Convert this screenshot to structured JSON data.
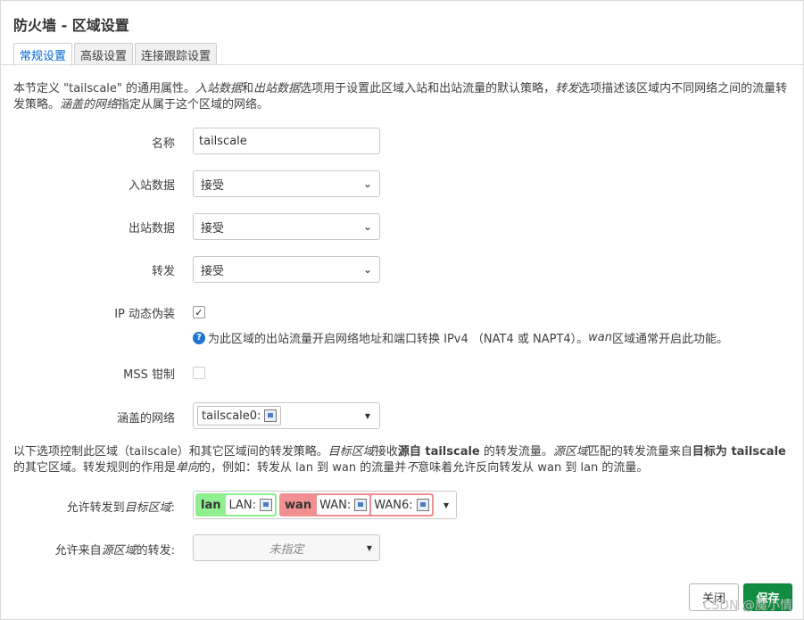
{
  "dialog": {
    "title": "防火墙 - 区域设置",
    "tabs": [
      {
        "label": "常规设置",
        "active": true
      },
      {
        "label": "高级设置",
        "active": false
      },
      {
        "label": "连接跟踪设置",
        "active": false
      }
    ],
    "description": {
      "p1": "本节定义 \"tailscale\" 的通用属性。",
      "em_in": "入站数据",
      "and": "和",
      "em_out": "出站数据",
      "p2": "选项用于设置此区域入站和出站流量的默认策略，",
      "em_fwd": "转发",
      "p3": "选项描述该区域内不同网络之间的流量转发策略。",
      "em_net": "涵盖的网络",
      "p4": "指定从属于这个区域的网络。"
    }
  },
  "form": {
    "name": {
      "label": "名称",
      "value": "tailscale"
    },
    "input": {
      "label": "入站数据",
      "value": "接受"
    },
    "output": {
      "label": "出站数据",
      "value": "接受"
    },
    "forward": {
      "label": "转发",
      "value": "接受"
    },
    "masq": {
      "label": "IP 动态伪装",
      "checked": true,
      "hint_pre": "为此区域的出站流量开启网络地址和端口转换 IPv4 （NAT4 或 NAPT4）。",
      "hint_em": "wan",
      "hint_post": "区域通常开启此功能。"
    },
    "mss": {
      "label": "MSS 钳制",
      "checked": false
    },
    "networks": {
      "label": "涵盖的网络",
      "chip": "tailscale0:"
    }
  },
  "forwarding_text": {
    "t1": "以下选项控制此区域（tailscale）和其它区域间的转发策略。",
    "em_dest": "目标区域",
    "t2": "接收",
    "b_src": "源自 tailscale",
    "t3": " 的转发流量。",
    "em_src": "源区域",
    "t4": "匹配的转发流量来自",
    "b_dest": "目标为 tailscale",
    "t5": " 的其它区域。转发规则的作用是",
    "em_uni": "单向",
    "t6": "的，例如：转发从 lan 到 wan 的流量并",
    "em_not": "不",
    "t7": "意味着允许反向转发从 wan 到 lan 的流量。"
  },
  "forwarding": {
    "dest_label_pre": "允许转发到",
    "dest_label_em": "目标区域",
    "dest_label_post": ":",
    "zones": [
      {
        "name": "lan",
        "color": "#90f090",
        "nets": [
          "LAN:"
        ]
      },
      {
        "name": "wan",
        "color": "#f09090",
        "nets": [
          "WAN:",
          "WAN6:"
        ]
      }
    ],
    "src_label_pre": "允许来自",
    "src_label_em": "源区域",
    "src_label_post": "的转发:",
    "src_value": "未指定"
  },
  "buttons": {
    "close": "关闭",
    "save": "保存"
  },
  "watermark": "CSDN @魔小情"
}
